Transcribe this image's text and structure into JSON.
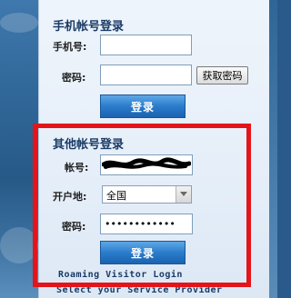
{
  "phone_login": {
    "title": "手机帐号登录",
    "phone_label": "手机号:",
    "phone_value": "",
    "password_label": "密码:",
    "password_value": "",
    "get_password_button": "获取密码",
    "login_button": "登录"
  },
  "other_login": {
    "title": "其他帐号登录",
    "account_label": "帐号:",
    "province_label": "开户地:",
    "province_value": "全国",
    "password_label": "密码:",
    "password_value": "••••••••••••",
    "login_button": "登录"
  },
  "footer": {
    "roaming": "Roaming Visitor Login",
    "provider": "Select your Service Provider"
  },
  "colors": {
    "highlight": "#e3151b",
    "login_button": "#2a7ccb",
    "title": "#1a3b66"
  }
}
